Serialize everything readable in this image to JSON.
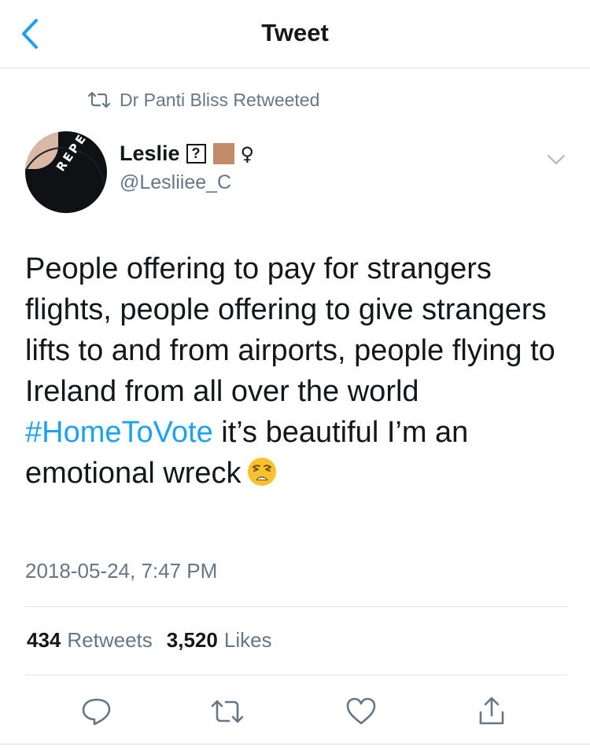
{
  "navbar": {
    "title": "Tweet"
  },
  "retweet_context": {
    "text": "Dr Panti Bliss Retweeted"
  },
  "author": {
    "name": "Leslie",
    "unknown_glyph": "?",
    "gender_symbol": "♀",
    "handle": "@Lesliiee_C",
    "avatar_text": "REPEAL"
  },
  "tweet": {
    "text_before": "People offering to pay for strangers flights, people offering to give strangers lifts to and from airports, people flying to Ireland from all over the world ",
    "hashtag": "#HomeToVote",
    "text_after": " it’s beautiful I’m an emotional wreck",
    "timestamp": "2018-05-24, 7:47 PM"
  },
  "stats": {
    "retweets_count": "434",
    "retweets_label": "Retweets",
    "likes_count": "3,520",
    "likes_label": "Likes"
  },
  "colors": {
    "accent": "#1da1f2",
    "secondary_text": "#657786",
    "divider": "#e1e8ed",
    "skin_tone": "#c28c69"
  },
  "icons": [
    "back-chevron-icon",
    "retweet-icon",
    "chevron-down-icon",
    "weary-face-emoji-icon",
    "reply-icon",
    "retweet-icon",
    "like-icon",
    "share-icon"
  ]
}
